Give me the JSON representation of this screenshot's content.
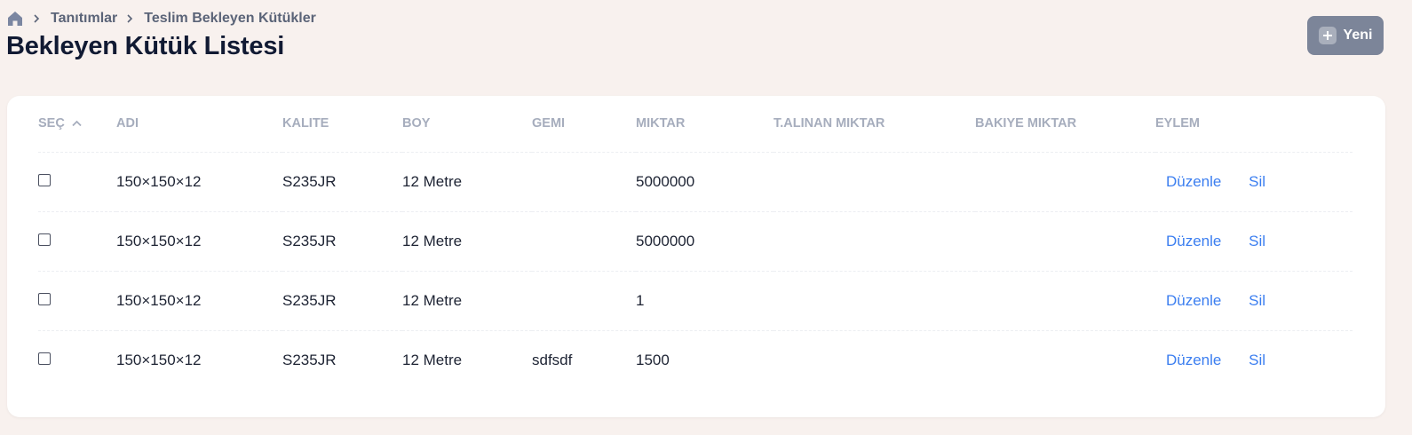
{
  "breadcrumb": {
    "items": [
      "Tanıtımlar",
      "Teslim Bekleyen Kütükler"
    ]
  },
  "page": {
    "title": "Bekleyen Kütük Listesi",
    "new_button_label": "Yeni"
  },
  "table": {
    "columns": [
      "SEÇ",
      "ADI",
      "KALITE",
      "BOY",
      "GEMI",
      "MIKTAR",
      "T.ALINAN MIKTAR",
      "BAKIYE MIKTAR",
      "EYLEM"
    ],
    "rows": [
      {
        "adi": "150×150×12",
        "kalite": "S235JR",
        "boy": "12 Metre",
        "gemi": "",
        "miktar": "5000000",
        "t_alinan": "",
        "bakiye": ""
      },
      {
        "adi": "150×150×12",
        "kalite": "S235JR",
        "boy": "12 Metre",
        "gemi": "",
        "miktar": "5000000",
        "t_alinan": "",
        "bakiye": ""
      },
      {
        "adi": "150×150×12",
        "kalite": "S235JR",
        "boy": "12 Metre",
        "gemi": "",
        "miktar": "1",
        "t_alinan": "",
        "bakiye": ""
      },
      {
        "adi": "150×150×12",
        "kalite": "S235JR",
        "boy": "12 Metre",
        "gemi": "sdfsdf",
        "miktar": "1500",
        "t_alinan": "",
        "bakiye": ""
      }
    ],
    "actions": {
      "edit": "Düzenle",
      "delete": "Sil"
    }
  },
  "icons": {
    "home": "home-icon",
    "separator": "chevron-right-icon",
    "sort": "chevron-up-icon",
    "new": "plus-icon"
  },
  "colors": {
    "background": "#f8f1ee",
    "primary_button": "#7c8599",
    "link": "#3b7ef0",
    "title": "#111a33"
  }
}
